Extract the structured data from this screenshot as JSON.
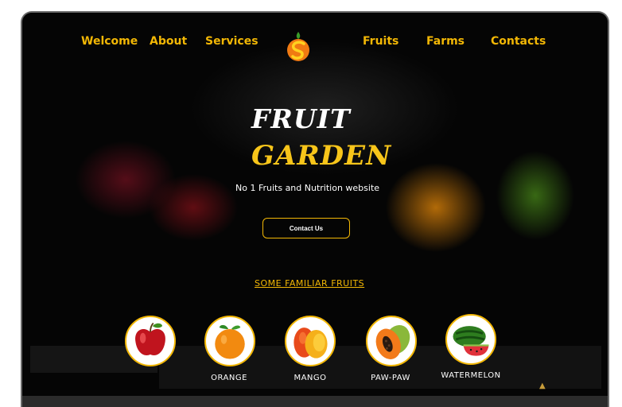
{
  "nav": {
    "left": [
      "Welcome",
      "About",
      "Services"
    ],
    "right": [
      "Fruits",
      "Farms",
      "Contacts"
    ],
    "logo": "orange-s-logo"
  },
  "hero": {
    "title_line1": "FRUIT",
    "title_line2": "GARDEN",
    "subtitle": "No 1 Fruits and Nutrition website",
    "button_label": "Contact Us"
  },
  "section": {
    "link_text": "SOME FAMILIAR FRUITS"
  },
  "fruits": [
    {
      "name": "",
      "icon": "apple-icon"
    },
    {
      "name": "ORANGE",
      "icon": "orange-icon"
    },
    {
      "name": "MANGO",
      "icon": "mango-icon"
    },
    {
      "name": "PAW-PAW",
      "icon": "pawpaw-icon"
    },
    {
      "name": "WATERMELON",
      "icon": "watermelon-icon"
    }
  ],
  "colors": {
    "accent": "#f2b705",
    "background": "#050505",
    "text": "#ffffff"
  }
}
